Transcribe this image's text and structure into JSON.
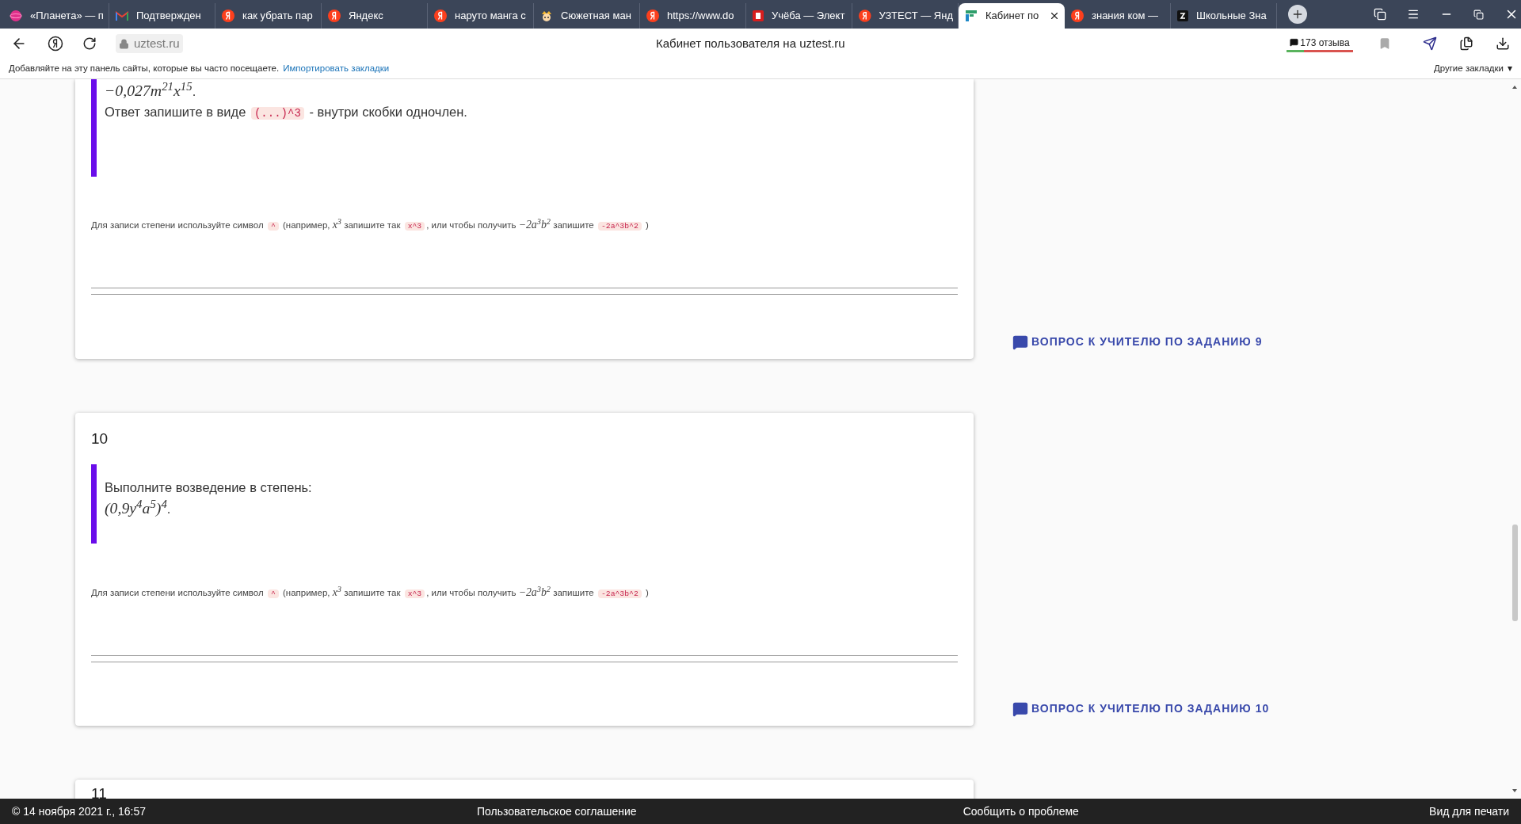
{
  "tabs": [
    {
      "title": "«Планета» — п",
      "kind": "planet",
      "selected": false
    },
    {
      "title": "Подтвержден",
      "kind": "mail",
      "selected": false
    },
    {
      "title": "как убрать пар",
      "kind": "yandex",
      "selected": false
    },
    {
      "title": "Яндекс",
      "kind": "yandex",
      "selected": false
    },
    {
      "title": "наруто манга с",
      "kind": "yandex",
      "selected": false
    },
    {
      "title": "Сюжетная ман",
      "kind": "mascot",
      "selected": false
    },
    {
      "title": "https://www.do",
      "kind": "yandex",
      "selected": false
    },
    {
      "title": "Учёба — Элект",
      "kind": "book",
      "selected": false
    },
    {
      "title": "УЗТЕСТ — Янд",
      "kind": "yandex",
      "selected": false
    },
    {
      "title": "Кабинет по",
      "kind": "site",
      "selected": true
    },
    {
      "title": "знания ком —",
      "kind": "yandex",
      "selected": false
    },
    {
      "title": "Школьные Зна",
      "kind": "school",
      "selected": false
    }
  ],
  "address_bar": {
    "url": "uztest.ru",
    "page_title": "Кабинет пользователя на uztest.ru",
    "reviews": "173 отзыва"
  },
  "bookmarks_bar": {
    "hint": "Добавляйте на эту панель сайты, которые вы часто посещаете.",
    "import_link": "Импортировать закладки",
    "other": "Другие закладки",
    "other_caret": "▾"
  },
  "tasks": [
    {
      "statement": [
        [
          {
            "kind": "math",
            "text": "−0,027m$^{21}$x$^{15}$"
          },
          {
            "kind": "text",
            "text": "."
          }
        ],
        [
          {
            "kind": "text",
            "text": "Ответ запишите в виде "
          },
          {
            "kind": "code",
            "text": "(...)^3"
          },
          {
            "kind": "text",
            "text": " - внутри скобки одночлен."
          }
        ]
      ],
      "hint": [
        {
          "kind": "text",
          "text": "Для записи степени используйте символ "
        },
        {
          "kind": "code",
          "text": "^"
        },
        {
          "kind": "text",
          "text": " (например, "
        },
        {
          "kind": "math",
          "text": "x$^{3}$"
        },
        {
          "kind": "text",
          "text": " запишите так "
        },
        {
          "kind": "code",
          "text": "x^3"
        },
        {
          "kind": "text",
          "text": ", или чтобы получить "
        },
        {
          "kind": "math",
          "text": "−2a$^{3}$b$^{2}$"
        },
        {
          "kind": "text",
          "text": " запишите "
        },
        {
          "kind": "code",
          "text": "-2a^3b^2"
        },
        {
          "kind": "text",
          "text": " )"
        }
      ],
      "teacher_link": "ВОПРОС К УЧИТЕЛЮ ПО ЗАДАНИЮ 9"
    },
    {
      "number": "10",
      "statement": [
        [
          {
            "kind": "text",
            "text": "Выполните возведение в степень:"
          }
        ],
        [
          {
            "kind": "math",
            "text": "(0,9y$^{4}$a$^{5}$)$^{4}$"
          },
          {
            "kind": "text",
            "text": "."
          }
        ]
      ],
      "hint": [
        {
          "kind": "text",
          "text": "Для записи степени используйте символ "
        },
        {
          "kind": "code",
          "text": "^"
        },
        {
          "kind": "text",
          "text": " (например, "
        },
        {
          "kind": "math",
          "text": "x$^{3}$"
        },
        {
          "kind": "text",
          "text": " запишите так "
        },
        {
          "kind": "code",
          "text": "x^3"
        },
        {
          "kind": "text",
          "text": ", или чтобы получить "
        },
        {
          "kind": "math",
          "text": "−2a$^{3}$b$^{2}$"
        },
        {
          "kind": "text",
          "text": " запишите "
        },
        {
          "kind": "code",
          "text": "-2a^3b^2"
        },
        {
          "kind": "text",
          "text": " )"
        }
      ],
      "teacher_link": "ВОПРОС К УЧИТЕЛЮ ПО ЗАДАНИЮ 10"
    },
    {
      "number": "11"
    }
  ],
  "footer": {
    "date": "© 14 ноября 2021 г., 16:57",
    "agreement": "Пользовательское соглашение",
    "report": "Сообщить о проблеме",
    "print": "Вид для печати"
  }
}
